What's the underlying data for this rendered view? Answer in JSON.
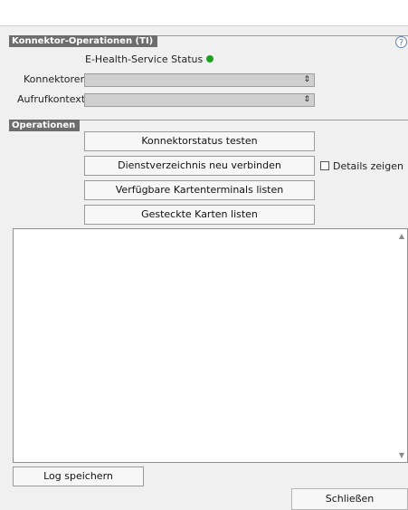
{
  "connector_section": {
    "title": "Konnektor-Operationen (TI)",
    "help_icon": "question-circle-icon",
    "status_label": "E-Health-Service Status",
    "status_color": "#1fa01f",
    "konnektoren_label": "Konnektoren",
    "konnektoren_value": "",
    "aufrufkontexte_label": "Aufrufkontexte",
    "aufrufkontexte_value": ""
  },
  "operations_section": {
    "title": "Operationen",
    "buttons": [
      "Konnektorstatus testen",
      "Dienstverzeichnis neu verbinden",
      "Verfügbare Kartenterminals listen",
      "Gesteckte Karten listen"
    ],
    "details_checkbox_label": "Details zeigen",
    "details_checked": false,
    "clear_icon": "eraser-icon"
  },
  "log": {
    "content": ""
  },
  "footer": {
    "save_log_label": "Log speichern",
    "close_label": "Schließen"
  }
}
